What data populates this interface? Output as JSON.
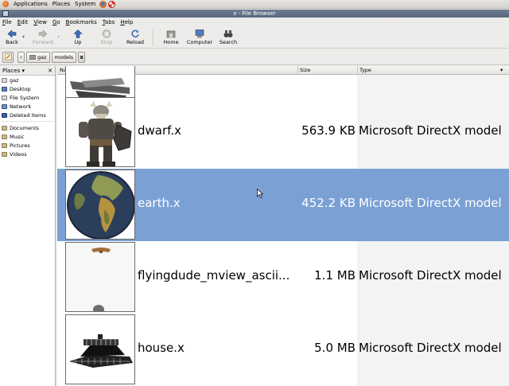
{
  "top_panel": {
    "menus": [
      "Applications",
      "Places",
      "System"
    ]
  },
  "window": {
    "title": "x - File Browser"
  },
  "menubar": [
    "File",
    "Edit",
    "View",
    "Go",
    "Bookmarks",
    "Tabs",
    "Help"
  ],
  "toolbar": {
    "back": "Back",
    "forward": "Forward",
    "up": "Up",
    "stop": "Stop",
    "reload": "Reload",
    "home": "Home",
    "computer": "Computer",
    "search": "Search"
  },
  "location": {
    "crumbs": [
      "gaz",
      "models",
      "x"
    ]
  },
  "sidebar": {
    "header": "Places",
    "items": [
      "gaz",
      "Desktop",
      "File System",
      "Network",
      "Deleted Items"
    ],
    "bookmarks": [
      "Documents",
      "Music",
      "Pictures",
      "Videos"
    ]
  },
  "columns": {
    "name": "Name",
    "size": "Size",
    "type": "Type"
  },
  "files": [
    {
      "name": "dwarf.x",
      "size": "563.9 KB",
      "type": "Microsoft DirectX model",
      "thumb": "dwarf"
    },
    {
      "name": "earth.x",
      "size": "452.2 KB",
      "type": "Microsoft DirectX model",
      "thumb": "earth"
    },
    {
      "name": "flyingdude_mview_ascii...",
      "size": "1.1 MB",
      "type": "Microsoft DirectX model",
      "thumb": "flyingdude"
    },
    {
      "name": "house.x",
      "size": "5.0 MB",
      "type": "Microsoft DirectX model",
      "thumb": "house"
    }
  ],
  "selected_file": "earth.x",
  "colors": {
    "selection": "#7ba0d4",
    "titlebar": "#5e6d82"
  }
}
